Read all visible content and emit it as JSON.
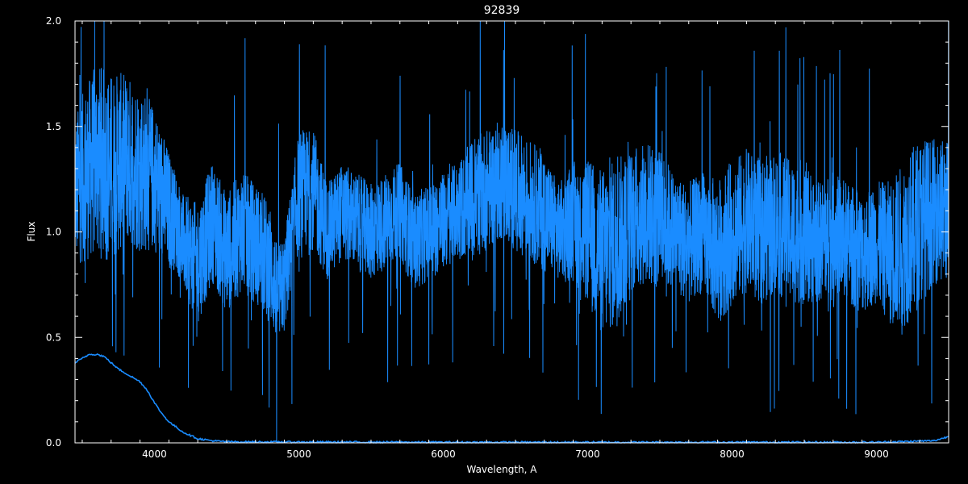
{
  "chart_data": {
    "type": "line",
    "title": "92839",
    "xlabel": "Wavelength, A",
    "ylabel": "Flux",
    "xlim": [
      3450,
      9500
    ],
    "ylim": [
      0,
      2
    ],
    "xticks": [
      4000,
      5000,
      6000,
      7000,
      8000,
      9000
    ],
    "xtick_labels": [
      "4000",
      "5000",
      "6000",
      "7000",
      "8000",
      "9000"
    ],
    "yticks": [
      0,
      0.5,
      1,
      1.5,
      2
    ],
    "ytick_labels": [
      "0.0",
      "0.5",
      "1.0",
      "1.5",
      "2.0"
    ],
    "grid": false,
    "legend": "none",
    "colors": {
      "background": "#000000",
      "axes": "#ffffff",
      "series": "#1a8cff"
    },
    "series": [
      {
        "role": "spectrum (approximate continuum with noise envelope)",
        "x": [
          3450,
          3500,
          3600,
          3700,
          3800,
          3900,
          4000,
          4100,
          4150,
          4200,
          4300,
          4400,
          4500,
          4600,
          4700,
          4800,
          4850,
          4900,
          5000,
          5100,
          5200,
          5300,
          5400,
          5500,
          5600,
          5700,
          5800,
          5900,
          6000,
          6100,
          6200,
          6300,
          6400,
          6500,
          6600,
          6700,
          6800,
          6900,
          7000,
          7100,
          7200,
          7300,
          7400,
          7500,
          7600,
          7700,
          7800,
          7900,
          8000,
          8100,
          8200,
          8300,
          8400,
          8500,
          8600,
          8700,
          8800,
          8900,
          9000,
          9100,
          9200,
          9300,
          9400,
          9500
        ],
        "y": [
          1.2,
          1.25,
          1.35,
          1.3,
          1.35,
          1.3,
          1.25,
          1.1,
          1.05,
          0.95,
          0.85,
          1.05,
          0.9,
          1.0,
          0.95,
          0.85,
          0.7,
          0.75,
          1.2,
          1.2,
          1.0,
          1.1,
          1.05,
          1.0,
          1.05,
          1.1,
          0.95,
          1.0,
          1.05,
          1.1,
          1.15,
          1.2,
          1.25,
          1.2,
          1.15,
          1.1,
          1.0,
          1.05,
          1.0,
          0.9,
          0.95,
          1.05,
          1.1,
          1.05,
          1.0,
          0.95,
          1.0,
          0.9,
          1.0,
          1.05,
          1.0,
          1.05,
          1.0,
          1.0,
          0.95,
          1.0,
          0.95,
          0.9,
          0.95,
          0.9,
          0.95,
          1.05,
          1.1,
          1.1
        ],
        "noise": [
          0.3,
          0.35,
          0.4,
          0.4,
          0.35,
          0.35,
          0.3,
          0.25,
          0.2,
          0.2,
          0.25,
          0.25,
          0.25,
          0.25,
          0.25,
          0.25,
          0.2,
          0.2,
          0.25,
          0.25,
          0.2,
          0.2,
          0.2,
          0.2,
          0.2,
          0.2,
          0.2,
          0.2,
          0.2,
          0.2,
          0.25,
          0.25,
          0.25,
          0.25,
          0.25,
          0.25,
          0.2,
          0.25,
          0.3,
          0.35,
          0.35,
          0.3,
          0.3,
          0.3,
          0.25,
          0.25,
          0.25,
          0.3,
          0.3,
          0.3,
          0.3,
          0.3,
          0.3,
          0.3,
          0.25,
          0.25,
          0.25,
          0.25,
          0.25,
          0.3,
          0.35,
          0.35,
          0.3,
          0.3
        ]
      },
      {
        "role": "error / sky curve",
        "x": [
          3450,
          3500,
          3550,
          3600,
          3650,
          3700,
          3750,
          3800,
          3850,
          3900,
          3950,
          4000,
          4050,
          4100,
          4200,
          4300,
          4400,
          4500,
          5000,
          6000,
          7000,
          8000,
          9000,
          9400,
          9450,
          9500
        ],
        "y": [
          0.38,
          0.4,
          0.42,
          0.42,
          0.41,
          0.38,
          0.35,
          0.33,
          0.31,
          0.29,
          0.25,
          0.19,
          0.14,
          0.1,
          0.05,
          0.02,
          0.01,
          0.005,
          0.004,
          0.003,
          0.003,
          0.003,
          0.003,
          0.01,
          0.02,
          0.03
        ]
      }
    ]
  }
}
